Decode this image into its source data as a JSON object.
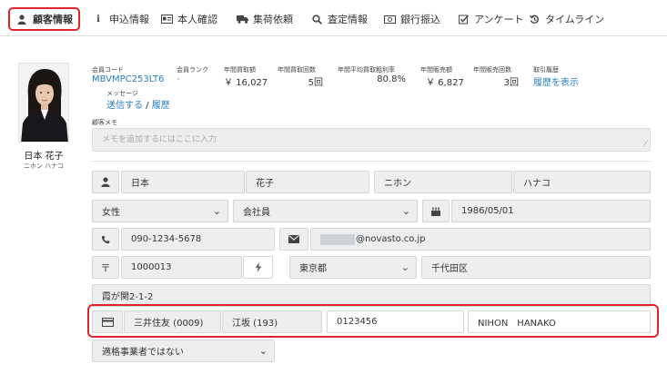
{
  "tabs": [
    {
      "icon": "user-icon",
      "glyph": "👤",
      "label": "顧客情報",
      "active": true
    },
    {
      "icon": "info-icon",
      "glyph": "ℹ",
      "label": "申込情報",
      "active": false
    },
    {
      "icon": "id-card-icon",
      "glyph": "▤",
      "label": "本人確認",
      "active": false
    },
    {
      "icon": "truck-icon",
      "glyph": "⛟",
      "label": "集荷依頼",
      "active": false
    },
    {
      "icon": "search-icon",
      "glyph": "⌕",
      "label": "査定情報",
      "active": false
    },
    {
      "icon": "banknote-icon",
      "glyph": "▣",
      "label": "銀行振込",
      "active": false
    },
    {
      "icon": "checkbox-icon",
      "glyph": "☑",
      "label": "アンケート",
      "active": false
    },
    {
      "icon": "history-icon",
      "glyph": "↺",
      "label": "タイムライン",
      "active": false
    }
  ],
  "customer": {
    "name": "日本 花子",
    "kana": "ニホン ハナコ"
  },
  "stats": {
    "member_code_label": "会員コード",
    "member_code": "MBVMPC253LT6",
    "rank_label": "会員ランク",
    "rank": "-",
    "annual_purchase_label": "年間買取額",
    "annual_purchase": "￥ 16,027",
    "annual_purchase_count_label": "年間買取回数",
    "annual_purchase_count": "5回",
    "avg_margin_label": "年間平均買取粗利率",
    "avg_margin": "80.8%",
    "annual_sales_label": "年間販売額",
    "annual_sales": "￥ 6,827",
    "annual_sales_count_label": "年間販売回数",
    "annual_sales_count": "3回",
    "history_label": "取引履歴",
    "history_link": "履歴を表示",
    "message_label": "メッセージ",
    "send_link": "送信する",
    "separator": " / ",
    "message_history_link": "履歴"
  },
  "memo": {
    "label": "顧客メモ",
    "placeholder": "メモを追加するにはここに入力"
  },
  "form": {
    "last_name": "日本",
    "first_name": "花子",
    "last_kana": "ニホン",
    "first_kana": "ハナコ",
    "gender": "女性",
    "occupation": "会社員",
    "birthday": "1986/05/01",
    "phone": "090-1234-5678",
    "email": "@novasto.co.jp",
    "zip_icon": "〒",
    "zip": "1000013",
    "prefecture": "東京都",
    "city": "千代田区",
    "address": "霞が関2-1-2",
    "bank": "三井住友 (0009)",
    "branch": "江坂 (193)",
    "account_number": "0123456",
    "account_holder": "NIHON　HANAKO",
    "qualification": "適格事業者ではない"
  },
  "colors": {
    "accent": "#e0262b",
    "link": "#2a7fc0",
    "field_bg": "#eceeef"
  }
}
